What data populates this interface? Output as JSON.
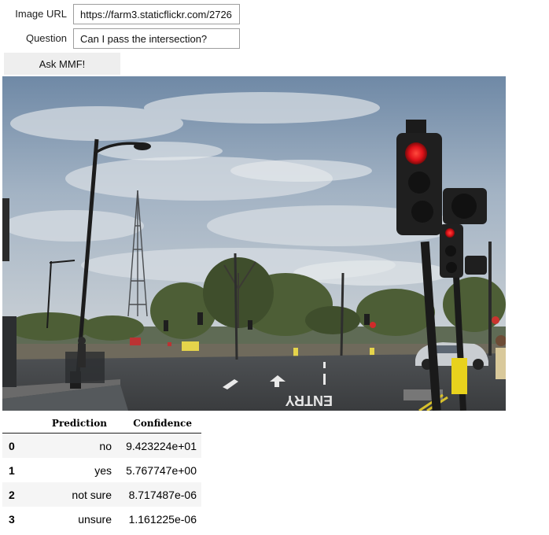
{
  "form": {
    "image_url_label": "Image URL",
    "image_url_value": "https://farm3.staticflickr.com/2726",
    "question_label": "Question",
    "question_value": "Can I pass the intersection?",
    "submit_label": "Ask MMF!"
  },
  "image": {
    "road_marking_text": "ENTRY"
  },
  "results": {
    "headers": {
      "index": "",
      "prediction": "Prediction",
      "confidence": "Confidence"
    },
    "rows": [
      {
        "index": "0",
        "prediction": "no",
        "confidence": "9.423224e+01"
      },
      {
        "index": "1",
        "prediction": "yes",
        "confidence": "5.767747e+00"
      },
      {
        "index": "2",
        "prediction": "not sure",
        "confidence": "8.717487e-06"
      },
      {
        "index": "3",
        "prediction": "unsure",
        "confidence": "1.161225e-06"
      }
    ]
  }
}
